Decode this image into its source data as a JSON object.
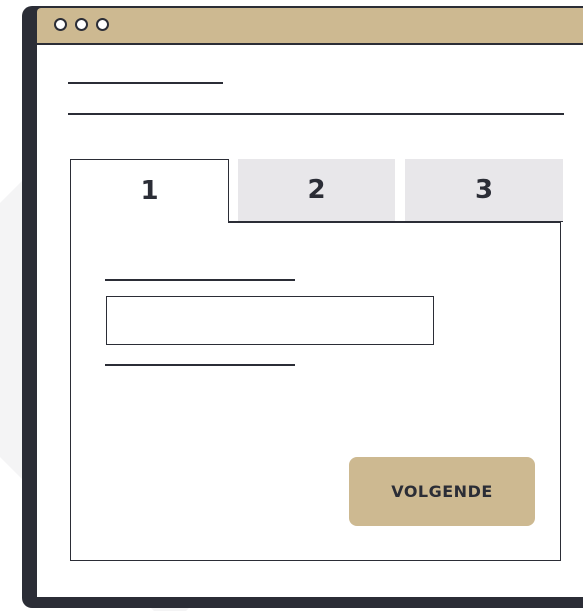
{
  "window": {
    "titlebar_color": "#cdb991",
    "frame_color": "#2b2d36",
    "controls": [
      "window-dot-icon",
      "window-dot-icon",
      "window-dot-icon"
    ]
  },
  "tabs": [
    {
      "label": "1",
      "active": true
    },
    {
      "label": "2",
      "active": false
    },
    {
      "label": "3",
      "active": false
    }
  ],
  "form": {
    "input_value": "",
    "next_label": "VOLGENDE",
    "accent_color": "#cdb991",
    "inactive_tab_color": "#e8e7ea"
  }
}
